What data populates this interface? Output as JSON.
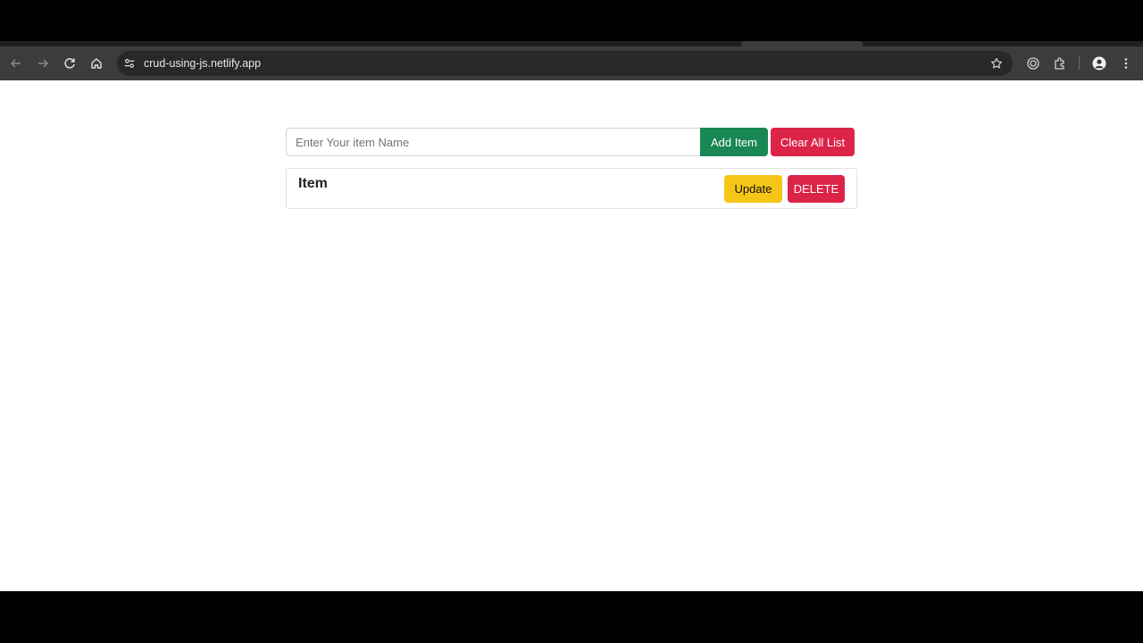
{
  "browser": {
    "url": "crud-using-js.netlify.app",
    "back_icon": "arrow-left-icon",
    "forward_icon": "arrow-right-icon",
    "reload_icon": "reload-icon",
    "home_icon": "home-icon",
    "site_info_icon": "tune-icon",
    "bookmark_icon": "star-icon",
    "extensions_icon": "puzzle-icon",
    "profile_icon": "avatar-icon",
    "menu_icon": "kebab-menu-icon"
  },
  "form": {
    "input_placeholder": "Enter Your item Name",
    "input_value": "",
    "add_label": "Add Item",
    "clear_label": "Clear All List"
  },
  "items": [
    {
      "title": "Item",
      "update_label": "Update",
      "delete_label": "DELETE"
    }
  ],
  "colors": {
    "add_button": "#198754",
    "danger_button": "#dc2448",
    "update_button": "#f5c518",
    "toolbar": "#3c3c3c"
  }
}
